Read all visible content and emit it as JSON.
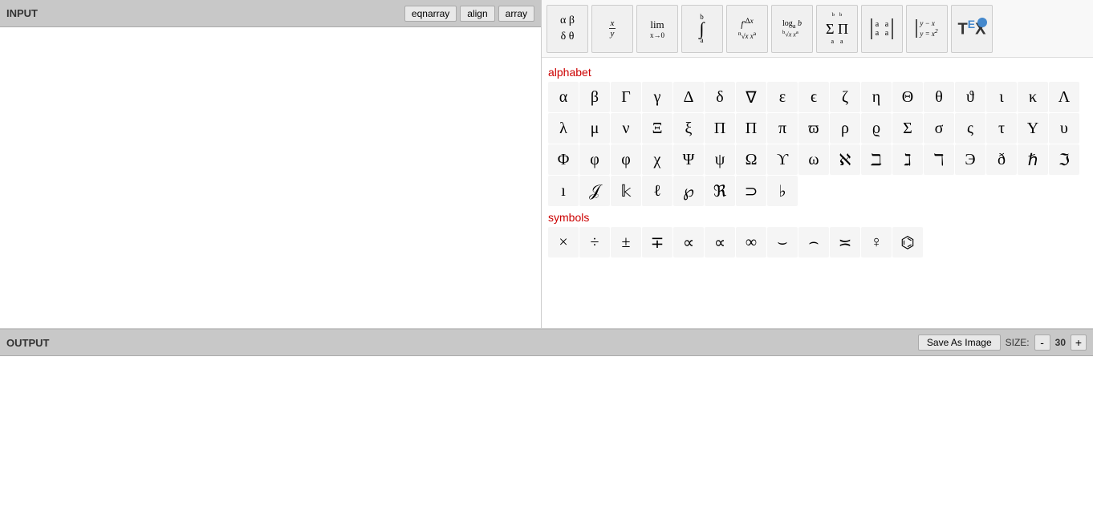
{
  "input": {
    "title": "INPUT",
    "buttons": [
      "eqnarray",
      "align",
      "array"
    ],
    "placeholder": ""
  },
  "output": {
    "title": "OUTPUT",
    "save_label": "Save As Image",
    "size_label": "SIZE:",
    "size_value": "30",
    "size_minus": "-",
    "size_plus": "+"
  },
  "toolbar": {
    "items": [
      {
        "name": "greek-ab",
        "display": "αβ/δθ"
      },
      {
        "name": "fraction",
        "display": "x/y"
      },
      {
        "name": "limit",
        "display": "lim x→0"
      },
      {
        "name": "integral",
        "display": "∫"
      },
      {
        "name": "derivative",
        "display": "f'Δx"
      },
      {
        "name": "logarithm",
        "display": "log"
      },
      {
        "name": "sum-product",
        "display": "Σ∏"
      },
      {
        "name": "matrix-2x2",
        "display": "[[a,a],[a,a]]"
      },
      {
        "name": "system",
        "display": "{y-x, y=x²"
      },
      {
        "name": "tex-logo",
        "display": "T"
      }
    ]
  },
  "alphabet": {
    "label": "alphabet",
    "symbols": [
      "α",
      "β",
      "Γ",
      "γ",
      "Δ",
      "δ",
      "∇",
      "ε",
      "ϵ",
      "ζ",
      "η",
      "Θ",
      "θ",
      "ϑ",
      "ι",
      "κ",
      "Λ",
      "λ",
      "μ",
      "ν",
      "Ξ",
      "ξ",
      "Π",
      "Π",
      "π",
      "ϖ",
      "ρ",
      "ϱ",
      "Σ",
      "σ",
      "ς",
      "τ",
      "Υ",
      "υ",
      "Φ",
      "φ",
      "φ",
      "χ",
      "Ψ",
      "ψ",
      "Ω",
      "ϒ",
      "ω",
      "ℵ",
      "ℶ",
      "ℷ",
      "ℸ",
      "Э",
      "ð",
      "ℏ",
      "ℑ",
      "ı",
      "ℐ",
      "𝕜",
      "ℓ",
      "℘",
      "ℜ",
      "⊃",
      "♭"
    ]
  },
  "symbols": {
    "label": "symbols",
    "symbols": [
      "×",
      "÷",
      "±",
      "∓",
      "∝",
      "∝",
      "∞",
      "⌣",
      "⌢",
      "≍",
      "♀",
      "⌬"
    ]
  }
}
